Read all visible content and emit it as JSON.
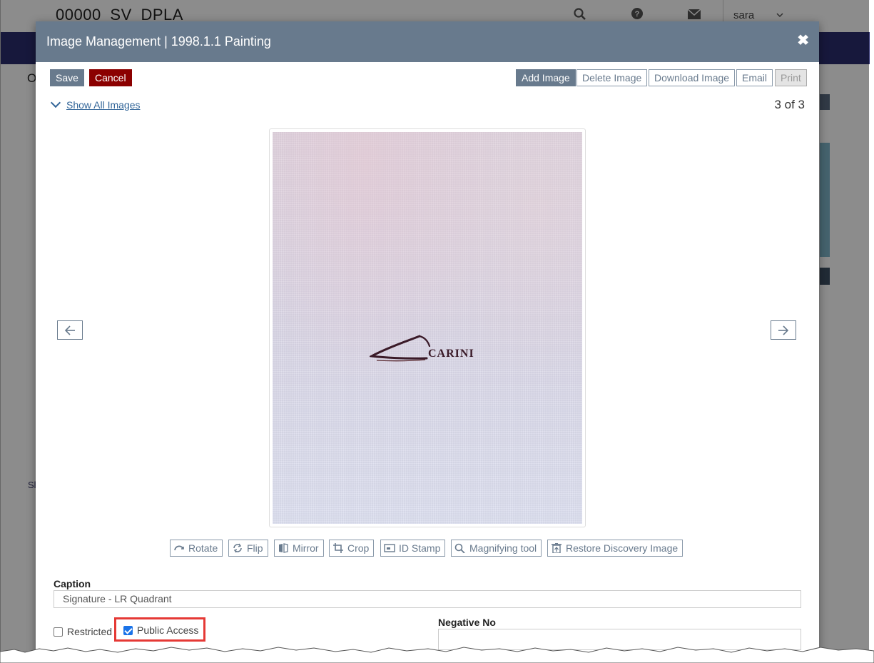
{
  "background": {
    "app_title": "00000_SV_DPLA",
    "user_name": "sara",
    "left_fragment": "O",
    "side_fragment": "Sl"
  },
  "modal": {
    "title": "Image Management | 1998.1.1 Painting",
    "close_label": "✖",
    "toolbar": {
      "save_label": "Save",
      "cancel_label": "Cancel",
      "add_image_label": "Add Image",
      "delete_image_label": "Delete Image",
      "download_image_label": "Download Image",
      "email_label": "Email",
      "print_label": "Print"
    },
    "show_all_label": "Show All Images",
    "image_counter": "3 of 3",
    "image": {
      "signature_text": "CARINI"
    },
    "tools": [
      {
        "label": "Rotate",
        "icon": "rotate-icon"
      },
      {
        "label": "Flip",
        "icon": "flip-icon"
      },
      {
        "label": "Mirror",
        "icon": "mirror-icon"
      },
      {
        "label": "Crop",
        "icon": "crop-icon"
      },
      {
        "label": "ID Stamp",
        "icon": "id-stamp-icon"
      },
      {
        "label": "Magnifying tool",
        "icon": "magnifier-icon"
      },
      {
        "label": "Restore Discovery Image",
        "icon": "restore-icon"
      }
    ],
    "caption": {
      "label": "Caption",
      "value": "Signature - LR Quadrant"
    },
    "restricted": {
      "label": "Restricted",
      "checked": false
    },
    "public_access": {
      "label": "Public Access",
      "checked": true
    },
    "negative_no": {
      "label": "Negative No",
      "value": ""
    },
    "colors": {
      "header": "#687a8d",
      "cancel": "#8b0000",
      "highlight": "#e53935",
      "nav_bar": "#2b2d6e"
    }
  }
}
